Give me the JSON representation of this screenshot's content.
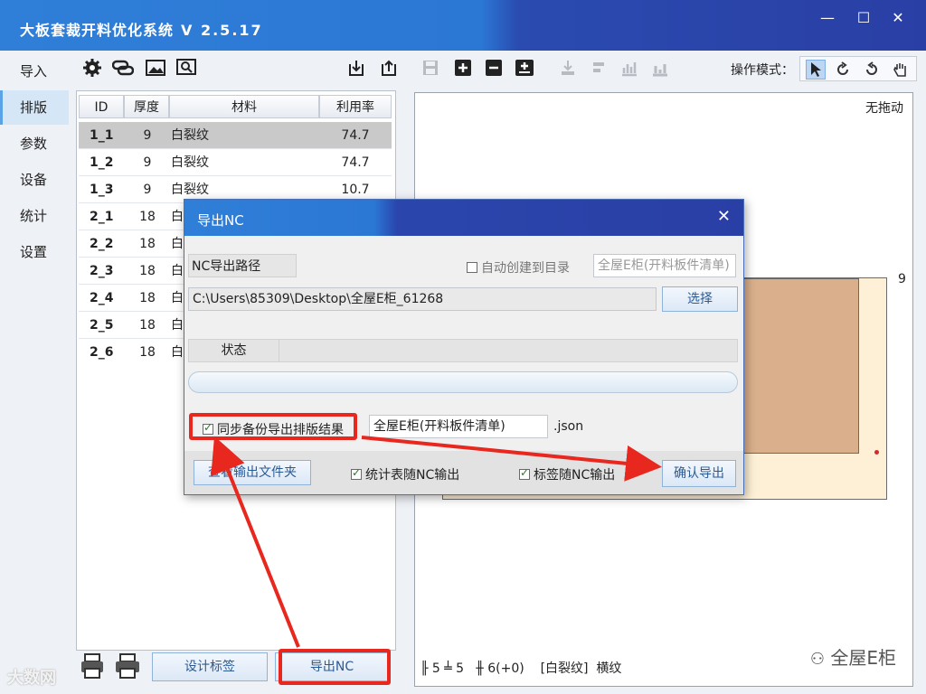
{
  "app": {
    "title": "大板套裁开料优化系统",
    "version": "V 2.5.17"
  },
  "window_controls": {
    "minimize": "—",
    "maximize": "☐",
    "close": "✕"
  },
  "nav": {
    "items": [
      {
        "label": "导入"
      },
      {
        "label": "排版",
        "active": true
      },
      {
        "label": "参数"
      },
      {
        "label": "设备"
      },
      {
        "label": "统计"
      },
      {
        "label": "设置"
      }
    ]
  },
  "toolbar": {
    "mode_label": "操作模式：",
    "icons": [
      "gear-icon",
      "chain-icon",
      "image-icon",
      "search-image-icon",
      "import-icon",
      "export-icon",
      "save-icon",
      "plus-icon",
      "minus-icon",
      "add-sheet-icon",
      "align-icon",
      "align2-icon",
      "chart-icon",
      "chart2-icon"
    ]
  },
  "table": {
    "headers": [
      "ID",
      "厚度",
      "材料",
      "利用率"
    ],
    "rows": [
      {
        "id": "1_1",
        "thickness": "9",
        "material": "白裂纹",
        "rate": "74.7"
      },
      {
        "id": "1_2",
        "thickness": "9",
        "material": "白裂纹",
        "rate": "74.7"
      },
      {
        "id": "1_3",
        "thickness": "9",
        "material": "白裂纹",
        "rate": "10.7"
      },
      {
        "id": "2_1",
        "thickness": "18",
        "material": "白"
      },
      {
        "id": "2_2",
        "thickness": "18",
        "material": "白"
      },
      {
        "id": "2_3",
        "thickness": "18",
        "material": "白"
      },
      {
        "id": "2_4",
        "thickness": "18",
        "material": "白"
      },
      {
        "id": "2_5",
        "thickness": "18",
        "material": "白"
      },
      {
        "id": "2_6",
        "thickness": "18",
        "material": "白"
      }
    ]
  },
  "bottom": {
    "design_label": "设计标签",
    "export_nc": "导出NC"
  },
  "canvas": {
    "drag_mode": "无拖动",
    "sheet_number": "9",
    "status_a": "╟ 5 ╧ 5",
    "status_b": "╫ 6(+0)",
    "status_c": "[白裂纹]",
    "status_d": "横纹",
    "watermark": "全屋E柜",
    "watermark2": "大数网"
  },
  "dialog": {
    "title": "导出NC",
    "path_label": "NC导出路径",
    "auto_create_label": "自动创建到目录",
    "auto_create_value": "全屋E柜(开料板件清单)",
    "path_value": "C:\\Users\\85309\\Desktop\\全屋E柜_61268",
    "choose_button": "选择",
    "status_header": "状态",
    "sync_backup_label": "同步备份导出排版结果",
    "backup_name": "全屋E柜(开料板件清单)",
    "backup_ext": ".json",
    "view_folder_button": "查看输出文件夹",
    "stats_with_nc": "统计表随NC输出",
    "label_with_nc": "标签随NC输出",
    "confirm_button": "确认导出"
  }
}
